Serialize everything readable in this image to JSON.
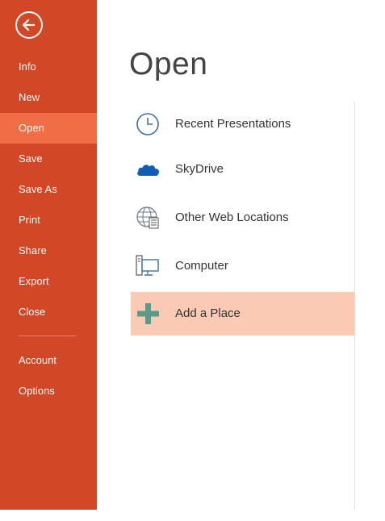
{
  "sidebar": {
    "items": [
      {
        "label": "Info"
      },
      {
        "label": "New"
      },
      {
        "label": "Open"
      },
      {
        "label": "Save"
      },
      {
        "label": "Save As"
      },
      {
        "label": "Print"
      },
      {
        "label": "Share"
      },
      {
        "label": "Export"
      },
      {
        "label": "Close"
      },
      {
        "label": "Account"
      },
      {
        "label": "Options"
      }
    ],
    "active": "Open",
    "back_icon": "back-arrow-icon"
  },
  "main": {
    "title": "Open",
    "places": [
      {
        "label": "Recent Presentations",
        "icon": "clock-icon"
      },
      {
        "label": "SkyDrive",
        "icon": "cloud-icon"
      },
      {
        "label": "Other Web Locations",
        "icon": "globe-document-icon"
      },
      {
        "label": "Computer",
        "icon": "computer-icon"
      },
      {
        "label": "Add a Place",
        "icon": "plus-icon"
      }
    ],
    "selected": "Add a Place"
  },
  "colors": {
    "sidebar": "#d24726",
    "sidebar_active": "#f06d46",
    "selected_place": "#fbcab4",
    "plus_icon": "#5b9a88",
    "cloud_icon": "#0f5db5"
  }
}
